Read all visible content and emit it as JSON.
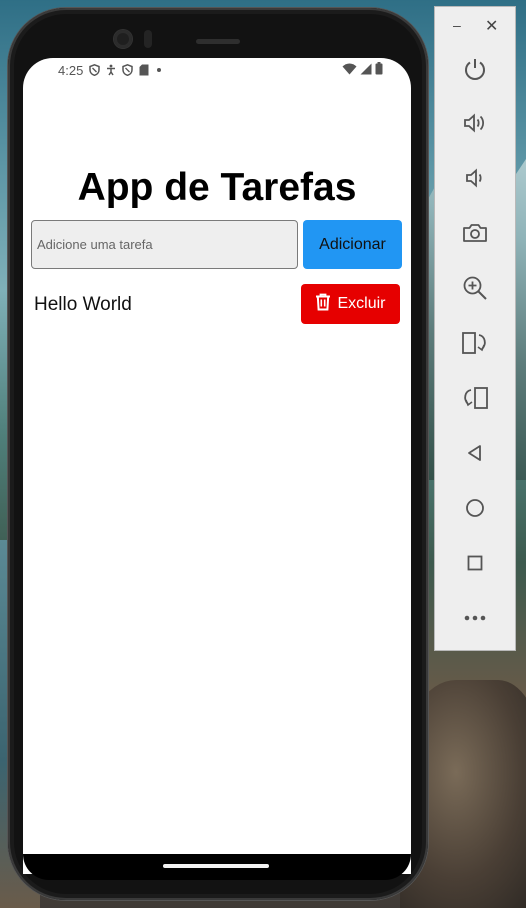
{
  "statusbar": {
    "time": "4:25"
  },
  "app": {
    "title": "App de Tarefas",
    "input_placeholder": "Adicione uma tarefa",
    "input_value": "",
    "add_label": "Adicionar",
    "tasks": [
      {
        "text": "Hello World",
        "delete_label": "Excluir"
      }
    ]
  },
  "emulator": {
    "minimize_glyph": "–",
    "close_glyph": "✕",
    "buttons": [
      "power-icon",
      "volume-up-icon",
      "volume-down-icon",
      "camera-icon",
      "zoom-in-icon",
      "rotate-left-icon",
      "rotate-right-icon",
      "back-icon",
      "home-icon",
      "overview-icon",
      "more-icon"
    ]
  },
  "colors": {
    "add_button": "#2196f3",
    "delete_button": "#e60000",
    "input_bg": "#eeeeee"
  }
}
